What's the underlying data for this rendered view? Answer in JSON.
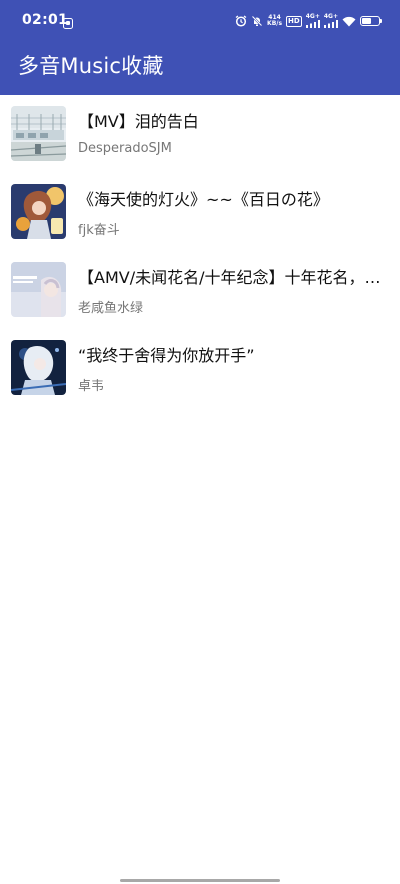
{
  "status_bar": {
    "time": "02:01",
    "net_speed_value": "414",
    "net_speed_unit": "KB/s",
    "hd_label": "HD",
    "sim1_label": "4G+",
    "sim2_label": "4G+",
    "battery_level": 0.55
  },
  "app_bar": {
    "title": "多音Music收藏"
  },
  "songs": [
    {
      "title": "【MV】泪的告白",
      "artist": "DesperadoSJM"
    },
    {
      "title": "《海天使的灯火》~~《百日の花》",
      "artist": "fjk奋斗"
    },
    {
      "title": "【AMV/未闻花名/十年纪念】十年花名，一生难忘",
      "artist": "老咸鱼水绿"
    },
    {
      "title": "“我终于舍得为你放开手”",
      "artist": "卓韦"
    }
  ],
  "colors": {
    "app_bar": "#3f51b5",
    "title_text": "#111111",
    "subtitle_text": "#777777"
  }
}
